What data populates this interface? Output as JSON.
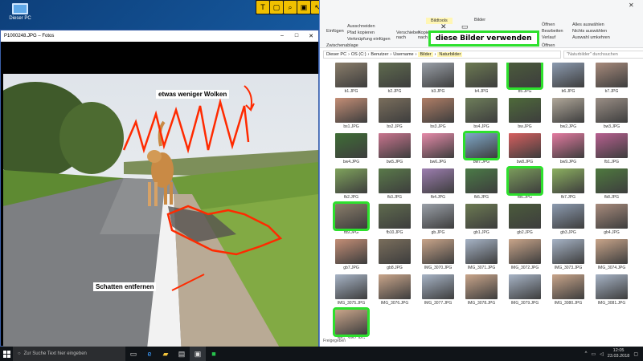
{
  "desktop": {
    "icon_label": "Dieser PC"
  },
  "photo_viewer": {
    "title": "P1000248.JPG – Fotos",
    "callout_top": "etwas weniger Wolken",
    "callout_bottom": "Schatten entfernen"
  },
  "banner": "diese Bilder verwenden",
  "explorer": {
    "ribbon": {
      "tab_tools": "Bildtools",
      "tab_pictures": "Bilder",
      "insert": "Einfügen",
      "cut": "Ausschneiden",
      "copy_path": "Pfad kopieren",
      "paste_shortcut": "Verknüpfung einfügen",
      "move_to": "Verschieben nach",
      "copy_to": "Kopieren nach",
      "clipboard_group": "Zwischenablage",
      "open": "Öffnen",
      "edit": "Bearbeiten",
      "history": "Verlauf",
      "open_group": "Öffnen",
      "select_all": "Alles auswählen",
      "select_none": "Nichts auswählen",
      "invert_selection": "Auswahl umkehren",
      "properties_suffix": "chaften"
    },
    "breadcrumb": [
      "Dieser PC",
      "OS (C:)",
      "Benutzer",
      "Username",
      "Bilder",
      "Naturbilder"
    ],
    "search_placeholder": "\"Naturbilder\" durchsuchen",
    "status": "Freigegeben",
    "files": [
      "b1.JPG",
      "b2.JPG",
      "b3.JPG",
      "b4.JPG",
      "b5.JPG",
      "b6.JPG",
      "b7.JPG",
      "bs1.JPG",
      "bs2.JPG",
      "bs3.JPG",
      "bs4.JPG",
      "bw.JPG",
      "bw2.JPG",
      "bw3.JPG",
      "bw4.JPG",
      "bw5.JPG",
      "bw6.JPG",
      "bw7.JPG",
      "bw8.JPG",
      "bw9.JPG",
      "fb1.JPG",
      "fb2.JPG",
      "fb3.JPG",
      "fb4.JPG",
      "fb5.JPG",
      "fb6.JPG",
      "fb7.JPG",
      "fb8.JPG",
      "fb9.JPG",
      "fb10.JPG",
      "gb.JPG",
      "gb1.JPG",
      "gb2.JPG",
      "gb3.JPG",
      "gb4.JPG",
      "gb7.JPG",
      "gb8.JPG",
      "IMG_3070.JPG",
      "IMG_3071.JPG",
      "IMG_3072.JPG",
      "IMG_3073.JPG",
      "IMG_3074.JPG",
      "IMG_3075.JPG",
      "IMG_3076.JPG",
      "IMG_3077.JPG",
      "IMG_3078.JPG",
      "IMG_3079.JPG",
      "IMG_3080.JPG",
      "IMG_3081.JPG",
      "IMG_3082.JPG"
    ],
    "highlighted": [
      "b5.JPG",
      "bw7.JPG",
      "fb6.JPG",
      "fb9.JPG",
      "IMG_3082.JPG"
    ]
  },
  "taskbar": {
    "search_placeholder": "Zur Suche Text hier eingeben",
    "time": "12:05",
    "date": "23.03.2018"
  },
  "colors": {
    "highlight": "#2de02d",
    "annotation": "#ff2a00"
  }
}
